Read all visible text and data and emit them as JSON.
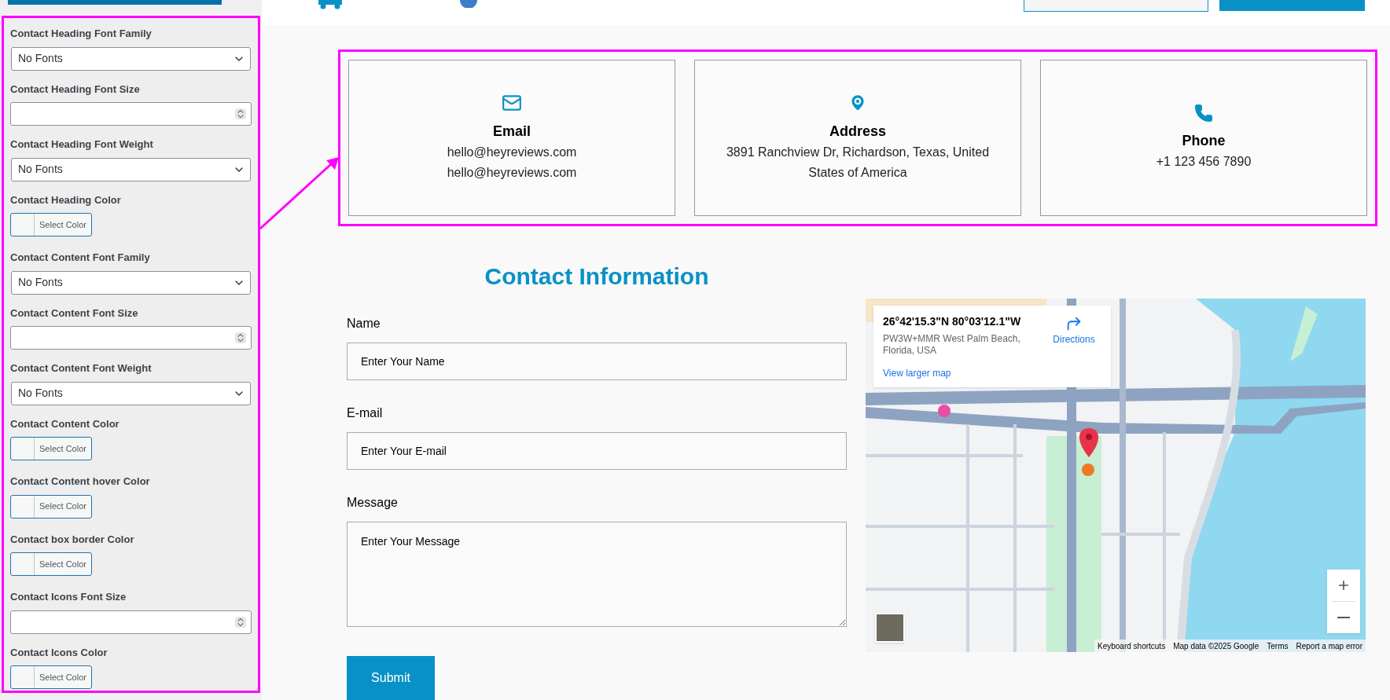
{
  "panel": {
    "settings": [
      {
        "kind": "select",
        "label": "Contact Heading Font Family",
        "value": "No Fonts"
      },
      {
        "kind": "number",
        "label": "Contact Heading Font Size"
      },
      {
        "kind": "select",
        "label": "Contact Heading Font Weight",
        "value": "No Fonts"
      },
      {
        "kind": "color",
        "label": "Contact Heading Color",
        "button": "Select Color"
      },
      {
        "kind": "select",
        "label": "Contact Content Font Family",
        "value": "No Fonts"
      },
      {
        "kind": "number",
        "label": "Contact Content Font Size"
      },
      {
        "kind": "select",
        "label": "Contact Content Font Weight",
        "value": "No Fonts"
      },
      {
        "kind": "color",
        "label": "Contact Content Color",
        "button": "Select Color"
      },
      {
        "kind": "color",
        "label": "Contact Content hover Color",
        "button": "Select Color"
      },
      {
        "kind": "color",
        "label": "Contact box border Color",
        "button": "Select Color"
      },
      {
        "kind": "number",
        "label": "Contact Icons Font Size"
      },
      {
        "kind": "color",
        "label": "Contact Icons Color",
        "button": "Select Color"
      }
    ]
  },
  "cards": [
    {
      "kind": "email",
      "title": "Email",
      "lines": [
        "hello@heyreviews.com",
        "hello@heyreviews.com"
      ]
    },
    {
      "kind": "address",
      "title": "Address",
      "lines": [
        "3891 Ranchview Dr, Richardson, Texas, United States of America"
      ]
    },
    {
      "kind": "phone",
      "title": "Phone",
      "lines": [
        "+1 123 456 7890"
      ]
    }
  ],
  "form": {
    "title": "Contact Information",
    "fields": [
      {
        "kind": "input",
        "label": "Name",
        "placeholder": "Enter Your Name"
      },
      {
        "kind": "input",
        "label": "E-mail",
        "placeholder": "Enter Your E-mail"
      },
      {
        "kind": "textarea",
        "label": "Message",
        "placeholder": "Enter Your Message"
      }
    ],
    "submit": "Submit"
  },
  "map": {
    "info": {
      "coords": "26°42'15.3\"N 80°03'12.1\"W",
      "address": "PW3W+MMR West Palm Beach, Florida, USA",
      "link": "View larger map",
      "directions": "Directions"
    },
    "footer": [
      "Keyboard shortcuts",
      "Map data ©2025 Google",
      "Terms",
      "Report a map error"
    ]
  }
}
